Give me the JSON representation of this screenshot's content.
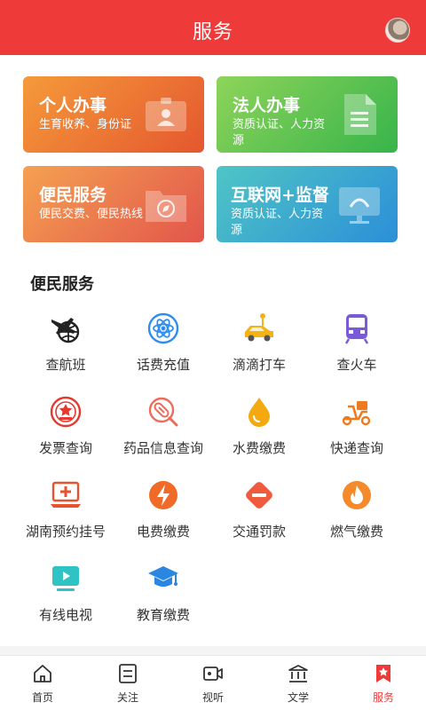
{
  "header": {
    "title": "服务"
  },
  "cards": [
    {
      "title": "个人办事",
      "subtitle": "生育收养、身份证"
    },
    {
      "title": "法人办事",
      "subtitle": "资质认证、人力资源"
    },
    {
      "title": "便民服务",
      "subtitle": "便民交费、便民热线"
    },
    {
      "title": "互联网+监督",
      "subtitle": "资质认证、人力资源"
    }
  ],
  "section": {
    "title": "便民服务"
  },
  "services": [
    {
      "label": "查航班",
      "icon": "plane-globe-icon"
    },
    {
      "label": "话费充值",
      "icon": "atom-icon"
    },
    {
      "label": "滴滴打车",
      "icon": "taxi-icon"
    },
    {
      "label": "查火车",
      "icon": "train-icon"
    },
    {
      "label": "发票查询",
      "icon": "emblem-icon"
    },
    {
      "label": "药品信息查询",
      "icon": "pill-icon"
    },
    {
      "label": "水费缴费",
      "icon": "water-drop-icon"
    },
    {
      "label": "快递查询",
      "icon": "scooter-icon"
    },
    {
      "label": "湖南预约挂号",
      "icon": "medical-laptop-icon"
    },
    {
      "label": "电费缴费",
      "icon": "lightning-icon"
    },
    {
      "label": "交通罚款",
      "icon": "no-entry-icon"
    },
    {
      "label": "燃气缴费",
      "icon": "flame-icon"
    },
    {
      "label": "有线电视",
      "icon": "tv-play-icon"
    },
    {
      "label": "教育缴费",
      "icon": "graduation-cap-icon"
    }
  ],
  "nav": [
    {
      "label": "首页",
      "icon": "home-icon"
    },
    {
      "label": "关注",
      "icon": "list-icon"
    },
    {
      "label": "视听",
      "icon": "camera-icon"
    },
    {
      "label": "文学",
      "icon": "building-icon"
    },
    {
      "label": "服务",
      "icon": "bookmark-star-icon",
      "active": true
    }
  ],
  "colors": {
    "primary": "#ef3a3a"
  }
}
